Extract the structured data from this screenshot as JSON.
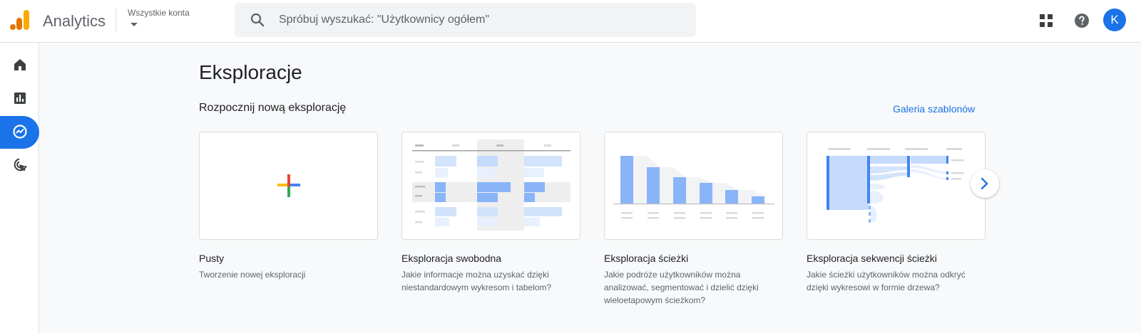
{
  "header": {
    "app_title": "Analytics",
    "account_label": "Wszystkie konta",
    "search_placeholder": "Spróbuj wyszukać: \"Użytkownicy ogółem\"",
    "avatar_letter": "K"
  },
  "sidebar": {
    "items": [
      {
        "name": "home-icon",
        "active": false
      },
      {
        "name": "reports-icon",
        "active": false
      },
      {
        "name": "explore-icon",
        "active": true
      },
      {
        "name": "advertising-icon",
        "active": false
      }
    ]
  },
  "main": {
    "page_title": "Eksploracje",
    "section_title": "Rozpocznij nową eksplorację",
    "gallery_link": "Galeria szablonów",
    "cards": [
      {
        "title": "Pusty",
        "description": "Tworzenie nowej eksploracji"
      },
      {
        "title": "Eksploracja swobodna",
        "description": "Jakie informacje można uzyskać dzięki niestandardowym wykresom i tabelom?"
      },
      {
        "title": "Eksploracja ścieżki",
        "description": "Jakie podróże użytkowników można analizować, segmentować i dzielić dzięki wieloetapowym ścieżkom?"
      },
      {
        "title": "Eksploracja sekwencji ścieżki",
        "description": "Jakie ścieżki użytkowników można odkryć dzięki wykresowi w formie drzewa?"
      }
    ]
  },
  "colors": {
    "accent": "#1a73e8",
    "logo_orange": "#f9ab00",
    "logo_dark_orange": "#e37400"
  }
}
